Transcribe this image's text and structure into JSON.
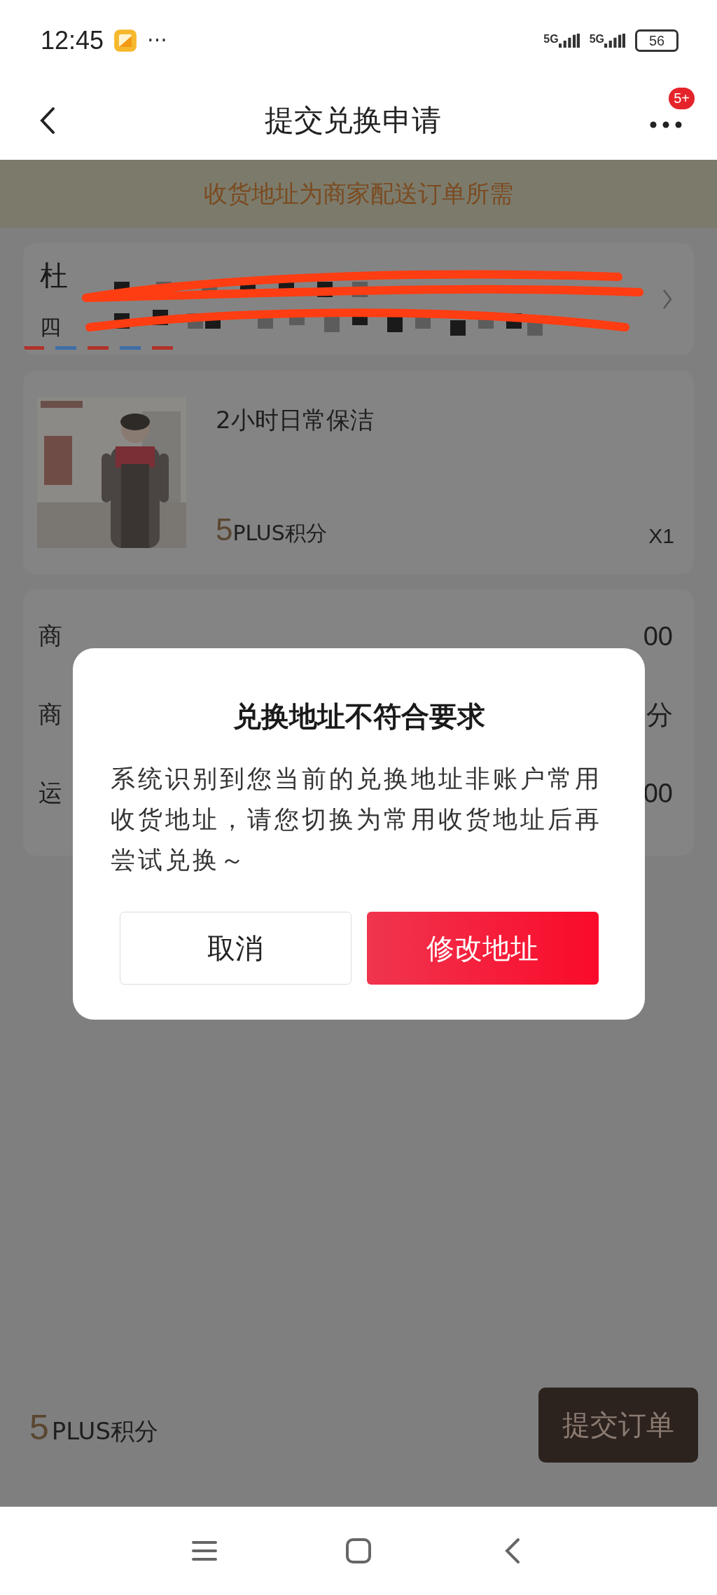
{
  "status_bar": {
    "time": "12:45",
    "more": "···",
    "network": [
      "5G",
      "5G"
    ],
    "battery": "56"
  },
  "header": {
    "title": "提交兑换申请",
    "badge": "5+"
  },
  "notice": "收货地址为商家配送订单所需",
  "address": {
    "name": "杜",
    "line": "四"
  },
  "product": {
    "title": "2小时日常保洁",
    "points": "5",
    "points_unit": "PLUS积分",
    "quantity": "X1"
  },
  "summary": {
    "rows": [
      {
        "label": "商",
        "value": "00"
      },
      {
        "label": "商",
        "value": "分"
      },
      {
        "label": "运",
        "value": "00"
      }
    ]
  },
  "dialog": {
    "title": "兑换地址不符合要求",
    "message": "系统识别到您当前的兑换地址非账户常用收货地址，请您切换为常用收货地址后再尝试兑换～",
    "buttons": [
      {
        "label": "取消",
        "kind": "secondary"
      },
      {
        "label": "修改地址",
        "kind": "primary"
      }
    ]
  },
  "footer": {
    "points": "5",
    "points_unit": "PLUS积分",
    "submit": "提交订单"
  }
}
